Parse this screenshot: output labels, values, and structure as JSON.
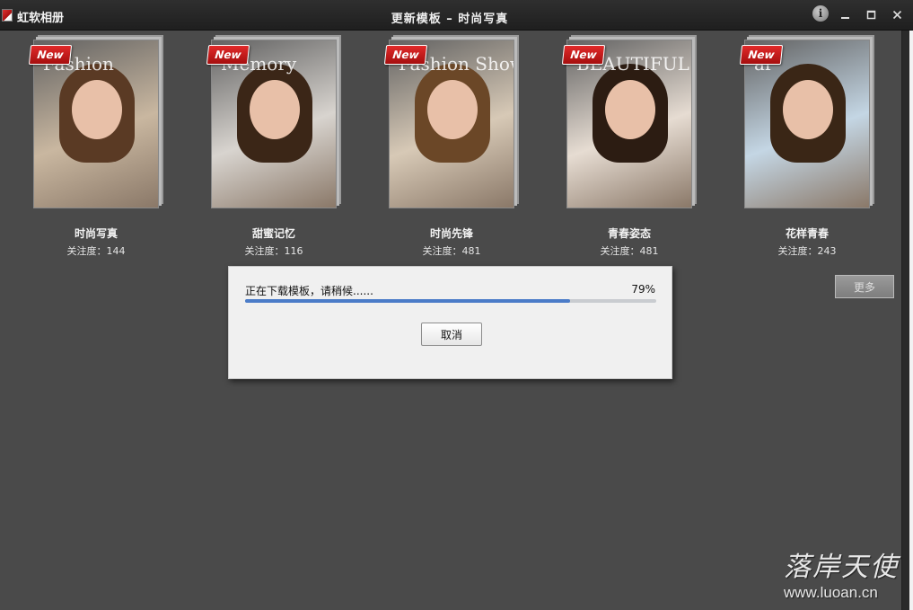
{
  "titlebar": {
    "app_name": "虹软相册",
    "window_title": "更新模板  –  时尚写真",
    "info_icon": "info-icon",
    "minimize_icon": "minimize-icon",
    "maximize_icon": "maximize-icon",
    "close_icon": "close-icon"
  },
  "badge_label": "New",
  "albums": [
    {
      "name": "时尚写真",
      "count": "关注度：144",
      "cover_text": "Fashion",
      "bg": "#c9b7a0",
      "hair": "#5a3a24"
    },
    {
      "name": "甜蜜记忆",
      "count": "关注度：116",
      "cover_text": "Memory",
      "bg": "#d8d4cf",
      "hair": "#3b2617"
    },
    {
      "name": "时尚先锋",
      "count": "关注度：481",
      "cover_text": "Fashion Show",
      "bg": "#d7c9b6",
      "hair": "#6b4727"
    },
    {
      "name": "青春姿态",
      "count": "关注度：481",
      "cover_text": "BEAUTIFUL",
      "bg": "#e6dcd2",
      "hair": "#2c1c12"
    },
    {
      "name": "花样青春",
      "count": "关注度：243",
      "cover_text": "ar",
      "bg": "#c4d6e4",
      "hair": "#3a2616"
    }
  ],
  "more_label": "更多",
  "dialog": {
    "message": "正在下载模板，请稍候......",
    "percent_label": "79%",
    "progress": 0.79,
    "cancel_label": "取消"
  },
  "watermark": {
    "brand": "落岸天使",
    "url": "www.luoan.cn"
  },
  "colors": {
    "background": "#4a4a4a",
    "progress_fill": "#4b7cc8",
    "badge": "#d21f1f"
  }
}
